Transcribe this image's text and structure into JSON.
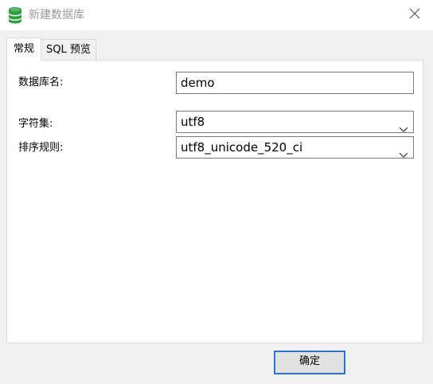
{
  "window": {
    "title": "新建数据库"
  },
  "tabs": [
    {
      "label": "常规",
      "active": true
    },
    {
      "label": "SQL 预览",
      "active": false
    }
  ],
  "form": {
    "db_name_label": "数据库名:",
    "db_name_value": "demo",
    "charset_label": "字符集:",
    "charset_value": "utf8",
    "collation_label": "排序规则:",
    "collation_value": "utf8_unicode_520_ci"
  },
  "footer": {
    "ok_label": "确定"
  },
  "colors": {
    "accent": "#2e74c4",
    "db_icon": "#2e9e3e"
  },
  "icons": [
    "database-icon",
    "close-icon",
    "chevron-down-icon"
  ]
}
